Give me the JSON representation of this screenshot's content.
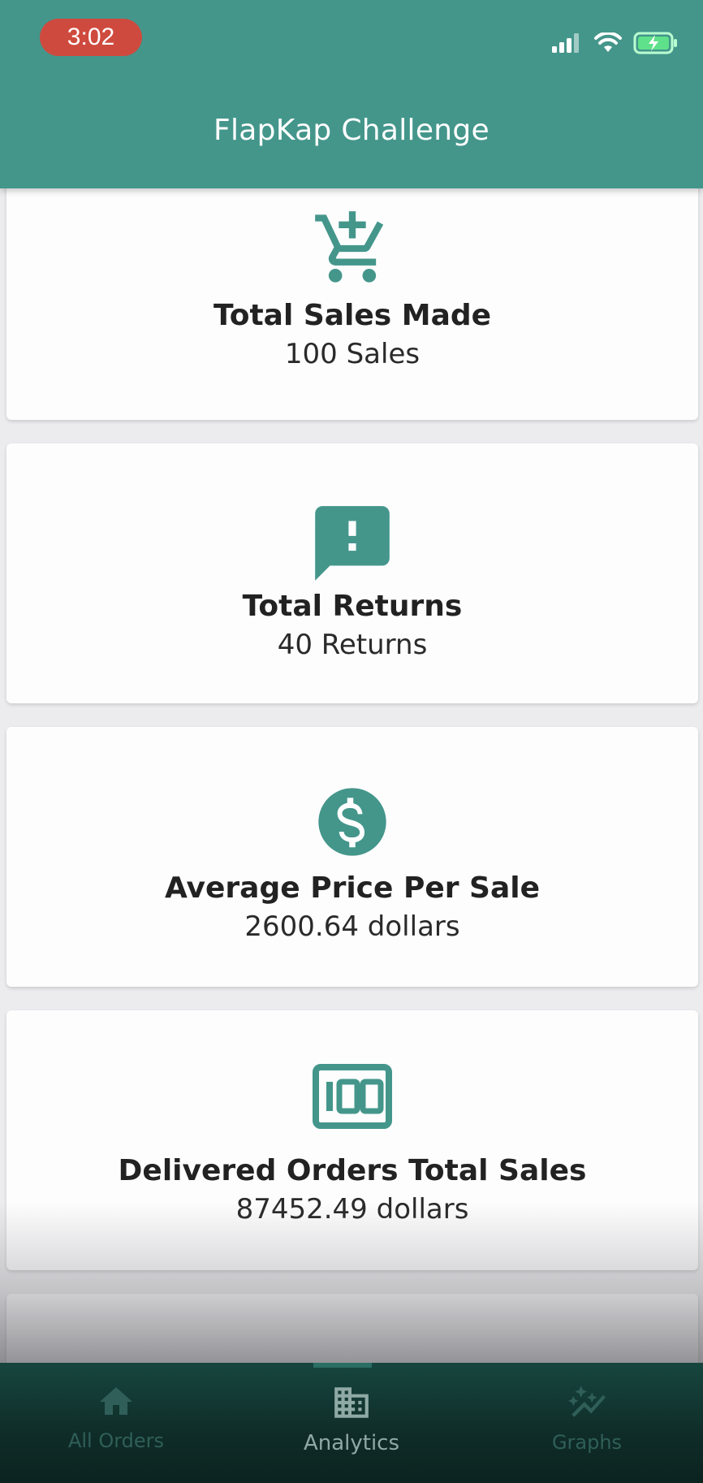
{
  "status_bar": {
    "time": "3:02"
  },
  "app_bar": {
    "title": "FlapKap Challenge"
  },
  "cards": [
    {
      "icon": "add-shopping-cart-icon",
      "title": "Total Sales Made",
      "value": "100 Sales"
    },
    {
      "icon": "feedback-icon",
      "title": "Total Returns",
      "value": "40 Returns"
    },
    {
      "icon": "monetization-icon",
      "title": "Average Price Per Sale",
      "value": "2600.64 dollars"
    },
    {
      "icon": "hundred-icon",
      "title": "Delivered Orders Total Sales",
      "value": "87452.49 dollars"
    }
  ],
  "bottom_nav": {
    "items": [
      {
        "label": "All Orders",
        "icon": "home-icon",
        "active": false
      },
      {
        "label": "Analytics",
        "icon": "business-icon",
        "active": true
      },
      {
        "label": "Graphs",
        "icon": "auto-graph-icon",
        "active": false
      }
    ]
  },
  "colors": {
    "primary": "#44968b",
    "status_pill": "#cf4a3e",
    "nav_background": "#0f2c28"
  }
}
